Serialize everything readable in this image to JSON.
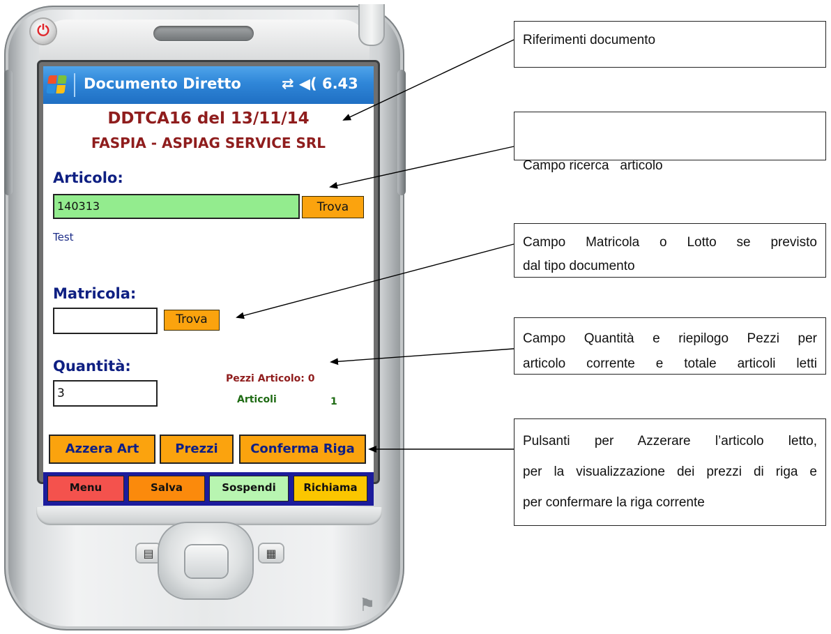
{
  "screen": {
    "title": "Documento Diretto",
    "status_icons": "⇄ ◀( ",
    "clock": "6.43",
    "doc_line1": "DDTCA16 del 13/11/14",
    "doc_line2": "FASPIA - ASPIAG SERVICE SRL",
    "articolo_label": "Articolo:",
    "articolo_value": "140313",
    "trova_label": "Trova",
    "articolo_desc": "Test",
    "matricola_label": "Matricola:",
    "matricola_value": "",
    "quantita_label": "Quantità:",
    "quantita_value": "3",
    "pezzi_label": "Pezzi Articolo:",
    "pezzi_value": "0",
    "articoli_label": "Articoli",
    "articoli_value": "1",
    "actions": {
      "azzera": "Azzera Art",
      "prezzi": "Prezzi",
      "conferma": "Conferma Riga"
    },
    "menu": {
      "menu": "Menu",
      "salva": "Salva",
      "sospendi": "Sospendi",
      "richiama": "Richiama"
    }
  },
  "callouts": {
    "c1": "Riferimenti documento",
    "c2": "Campo ricerca   articolo",
    "c3_line1": "Campo Matricola o Lotto se previsto",
    "c3_line2": "dal tipo documento",
    "c4_line1": "Campo Quantità e riepilogo Pezzi per",
    "c4_line2": "articolo corrente e totale articoli letti",
    "c5_line1": "Pulsanti per Azzerare l’articolo letto,",
    "c5_line2": "per la visualizzazione dei prezzi di riga e",
    "c5_line3": "per confermare la riga corrente"
  },
  "colors": {
    "title_bar": "#2f86d8",
    "doc_ref": "#8f1d1d",
    "label": "#0e1f82",
    "button": "#fba30e",
    "field_green": "#93ec8e",
    "menu_red": "#f4524d",
    "menu_orange": "#fb8a0c",
    "menu_green": "#b8f5b1",
    "menu_yellow": "#fbc600",
    "menu_bar": "#1c1c9c"
  }
}
